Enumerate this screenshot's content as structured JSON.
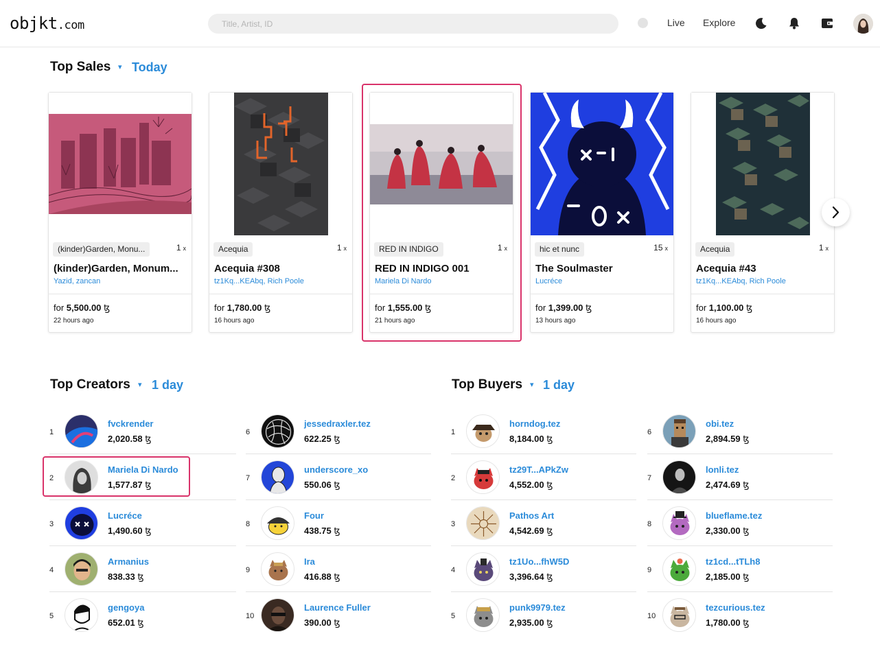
{
  "header": {
    "logo_main": "objkt",
    "logo_suffix": ".com",
    "search_placeholder": "Title, Artist, ID",
    "nav_live": "Live",
    "nav_explore": "Explore"
  },
  "top_sales": {
    "title": "Top Sales",
    "period": "Today",
    "cards": [
      {
        "tag": "(kinder)Garden, Monu...",
        "editions": "1",
        "title": "(kinder)Garden, Monum...",
        "artist": "Yazid, zancan",
        "price": "5,500.00",
        "time": "22 hours ago"
      },
      {
        "tag": "Acequia",
        "editions": "1",
        "title": "Acequia #308",
        "artist": "tz1Kq...KEAbq, Rich Poole",
        "price": "1,780.00",
        "time": "16 hours ago"
      },
      {
        "tag": "RED IN INDIGO",
        "editions": "1",
        "title": "RED IN INDIGO 001",
        "artist": "Mariela Di Nardo",
        "price": "1,555.00",
        "time": "21 hours ago"
      },
      {
        "tag": "hic et nunc",
        "editions": "15",
        "title": "The Soulmaster",
        "artist": "Lucréce",
        "price": "1,399.00",
        "time": "13 hours ago"
      },
      {
        "tag": "Acequia",
        "editions": "1",
        "title": "Acequia #43",
        "artist": "tz1Kq...KEAbq, Rich Poole",
        "price": "1,100.00",
        "time": "16 hours ago"
      }
    ],
    "price_prefix": "for",
    "edition_suffix": "x",
    "currency": "ꜩ"
  },
  "top_creators": {
    "title": "Top Creators",
    "period": "1 day",
    "rows": [
      {
        "rank": "1",
        "name": "fvckrender",
        "volume": "2,020.58"
      },
      {
        "rank": "2",
        "name": "Mariela Di Nardo",
        "volume": "1,577.87"
      },
      {
        "rank": "3",
        "name": "Lucréce",
        "volume": "1,490.60"
      },
      {
        "rank": "4",
        "name": "Armanius",
        "volume": "838.33"
      },
      {
        "rank": "5",
        "name": "gengoya",
        "volume": "652.01"
      },
      {
        "rank": "6",
        "name": "jessedraxler.tez",
        "volume": "622.25"
      },
      {
        "rank": "7",
        "name": "underscore_xo",
        "volume": "550.06"
      },
      {
        "rank": "8",
        "name": "Four",
        "volume": "438.75"
      },
      {
        "rank": "9",
        "name": "Ira",
        "volume": "416.88"
      },
      {
        "rank": "10",
        "name": "Laurence Fuller",
        "volume": "390.00"
      }
    ]
  },
  "top_buyers": {
    "title": "Top Buyers",
    "period": "1 day",
    "rows": [
      {
        "rank": "1",
        "name": "horndog.tez",
        "volume": "8,184.00"
      },
      {
        "rank": "2",
        "name": "tz29T...APkZw",
        "volume": "4,552.00"
      },
      {
        "rank": "3",
        "name": "Pathos Art",
        "volume": "4,542.69"
      },
      {
        "rank": "4",
        "name": "tz1Uo...fhW5D",
        "volume": "3,396.64"
      },
      {
        "rank": "5",
        "name": "punk9979.tez",
        "volume": "2,935.00"
      },
      {
        "rank": "6",
        "name": "obi.tez",
        "volume": "2,894.59"
      },
      {
        "rank": "7",
        "name": "lonli.tez",
        "volume": "2,474.69"
      },
      {
        "rank": "8",
        "name": "blueflame.tez",
        "volume": "2,330.00"
      },
      {
        "rank": "9",
        "name": "tz1cd...tTLh8",
        "volume": "2,185.00"
      },
      {
        "rank": "10",
        "name": "tezcurious.tez",
        "volume": "1,780.00"
      }
    ]
  },
  "colors": {
    "accent_blue": "#2b8bd9",
    "highlight_pink": "#d9336a"
  },
  "icons": [
    "moon-icon",
    "bell-icon",
    "wallet-icon",
    "chevron-right-icon",
    "caret-down-icon"
  ]
}
